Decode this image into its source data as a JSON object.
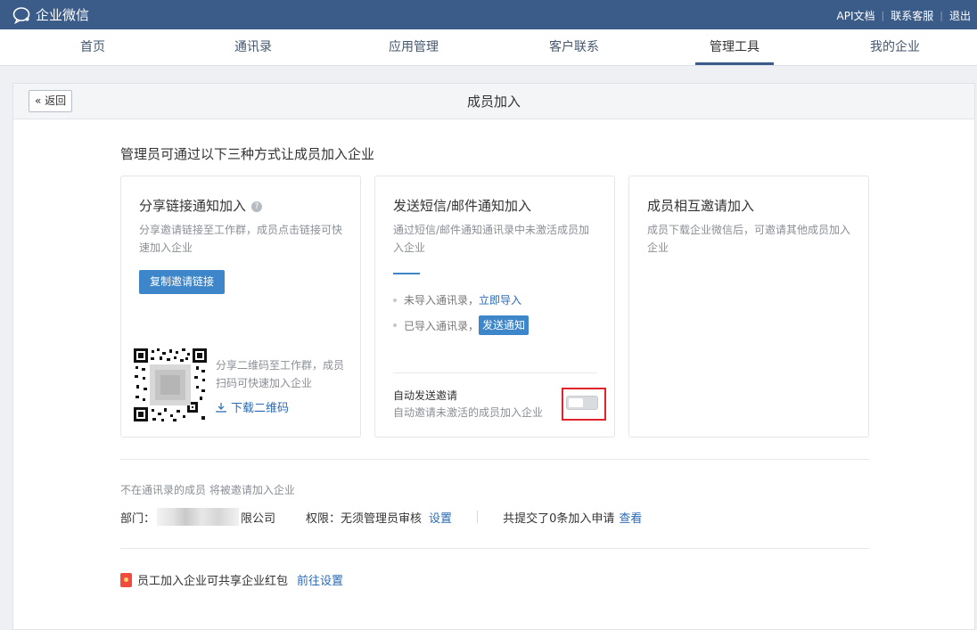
{
  "app": {
    "title": "企业微信"
  },
  "top_links": [
    "API文档",
    "联系客服",
    "退出"
  ],
  "nav": [
    {
      "label": "首页",
      "active": false
    },
    {
      "label": "通讯录",
      "active": false
    },
    {
      "label": "应用管理",
      "active": false
    },
    {
      "label": "客户联系",
      "active": false
    },
    {
      "label": "管理工具",
      "active": true
    },
    {
      "label": "我的企业",
      "active": false
    }
  ],
  "panel": {
    "back_label": "返回",
    "title": "成员加入"
  },
  "intro": "管理员可通过以下三种方式让成员加入企业",
  "card_link": {
    "title": "分享链接通知加入",
    "desc": "分享邀请链接至工作群，成员点击链接可快速加入企业",
    "copy_button": "复制邀请链接",
    "qr_desc": "分享二维码至工作群，成员扫码可快速加入企业",
    "qr_download": "下载二维码"
  },
  "card_sms": {
    "title": "发送短信/邮件通知加入",
    "desc": "通过短信/邮件通知通讯录中未激活成员加入企业",
    "row1_text": "未导入通讯录，",
    "row1_link": "立即导入",
    "row2_text": "已导入通讯录，",
    "row2_button": "发送通知",
    "auto_title": "自动发送邀请",
    "auto_desc": "自动邀请未激活的成员加入企业",
    "auto_enabled": false
  },
  "card_mutual": {
    "title": "成员相互邀请加入",
    "desc": "成员下载企业微信后，可邀请其他成员加入企业"
  },
  "footer": {
    "note": "不在通讯录的成员 将被邀请加入企业",
    "dept_label": "部门：",
    "dept_suffix": "限公司",
    "perm_label": "权限：无须管理员审核",
    "perm_link": "设置",
    "submitted_text": "共提交了0条加入申请",
    "submitted_link": "查看",
    "redpack_text": "员工加入企业可共享企业红包",
    "redpack_link": "前往设置"
  },
  "colors": {
    "brand": "#3b5c89",
    "primary": "#3e86ca",
    "link": "#2a6bb5",
    "highlight": "#e0232a"
  }
}
